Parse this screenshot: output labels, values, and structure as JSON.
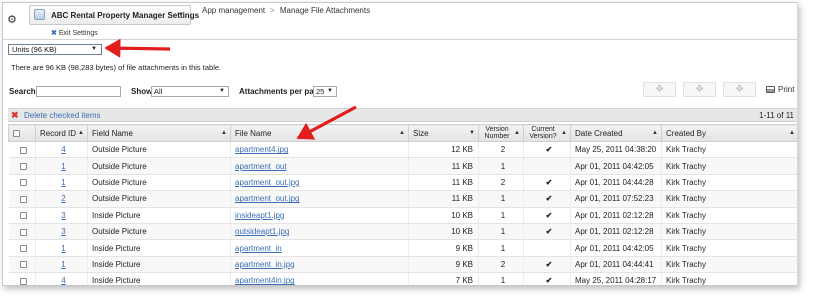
{
  "header": {
    "app_name": "ABC Rental Property Manager Settings",
    "exit_settings": "Exit Settings",
    "breadcrumbs": [
      "App management",
      "Manage File Attachments"
    ]
  },
  "units_select": {
    "value": "Units (96 KB)"
  },
  "info_text": "There are 96 KB (98,283 bytes) of file attachments in this table.",
  "controls": {
    "search_label": "Search",
    "search_value": "",
    "show_label": "Show",
    "show_value": "All",
    "per_page_label": "Attachments per page",
    "per_page_value": "25",
    "print_label": "Print"
  },
  "delete_bar": {
    "delete_label": "Delete checked items",
    "count_label": "1-11 of 11"
  },
  "table": {
    "columns": [
      "Record ID",
      "Field Name",
      "File Name",
      "Size",
      "Version Number",
      "Current Version?",
      "Date Created",
      "Created By"
    ],
    "rows": [
      {
        "record_id": "4",
        "field": "Outside Picture",
        "file": "apartment4.jpg",
        "size": "12 KB",
        "version": "2",
        "current": true,
        "date": "May 25, 2011 04:38:20",
        "by": "Kirk Trachy"
      },
      {
        "record_id": "1",
        "field": "Outside Picture",
        "file": "apartment_out",
        "size": "11 KB",
        "version": "1",
        "current": false,
        "date": "Apr 01, 2011 04:42:05",
        "by": "Kirk Trachy"
      },
      {
        "record_id": "1",
        "field": "Outside Picture",
        "file": "apartment_out.jpg",
        "size": "11 KB",
        "version": "2",
        "current": true,
        "date": "Apr 01, 2011 04:44:28",
        "by": "Kirk Trachy"
      },
      {
        "record_id": "2",
        "field": "Outside Picture",
        "file": "apartment_out.jpg",
        "size": "11 KB",
        "version": "1",
        "current": true,
        "date": "Apr 01, 2011 07:52:23",
        "by": "Kirk Trachy"
      },
      {
        "record_id": "3",
        "field": "Inside Picture",
        "file": "insideapt1.jpg",
        "size": "10 KB",
        "version": "1",
        "current": true,
        "date": "Apr 01, 2011 02:12:28",
        "by": "Kirk Trachy"
      },
      {
        "record_id": "3",
        "field": "Outside Picture",
        "file": "outsideapt1.jpg",
        "size": "10 KB",
        "version": "1",
        "current": true,
        "date": "Apr 01, 2011 02:12:28",
        "by": "Kirk Trachy"
      },
      {
        "record_id": "1",
        "field": "Inside Picture",
        "file": "apartment_in",
        "size": "9 KB",
        "version": "1",
        "current": false,
        "date": "Apr 01, 2011 04:42:05",
        "by": "Kirk Trachy"
      },
      {
        "record_id": "1",
        "field": "Inside Picture",
        "file": "apartment_in.jpg",
        "size": "9 KB",
        "version": "2",
        "current": true,
        "date": "Apr 01, 2011 04:44:41",
        "by": "Kirk Trachy"
      },
      {
        "record_id": "4",
        "field": "Inside Picture",
        "file": "apartment4in.jpg",
        "size": "7 KB",
        "version": "1",
        "current": true,
        "date": "May 25, 2011 04:28:17",
        "by": "Kirk Trachy"
      }
    ]
  },
  "colors": {
    "link": "#3a6fb5",
    "check": "#3f9f2f",
    "annotation_arrow": "#e21d1d"
  },
  "icons": [
    "gear-icon",
    "app-icon",
    "close-icon",
    "puzzle-icon",
    "print-icon",
    "checkmark-icon"
  ]
}
